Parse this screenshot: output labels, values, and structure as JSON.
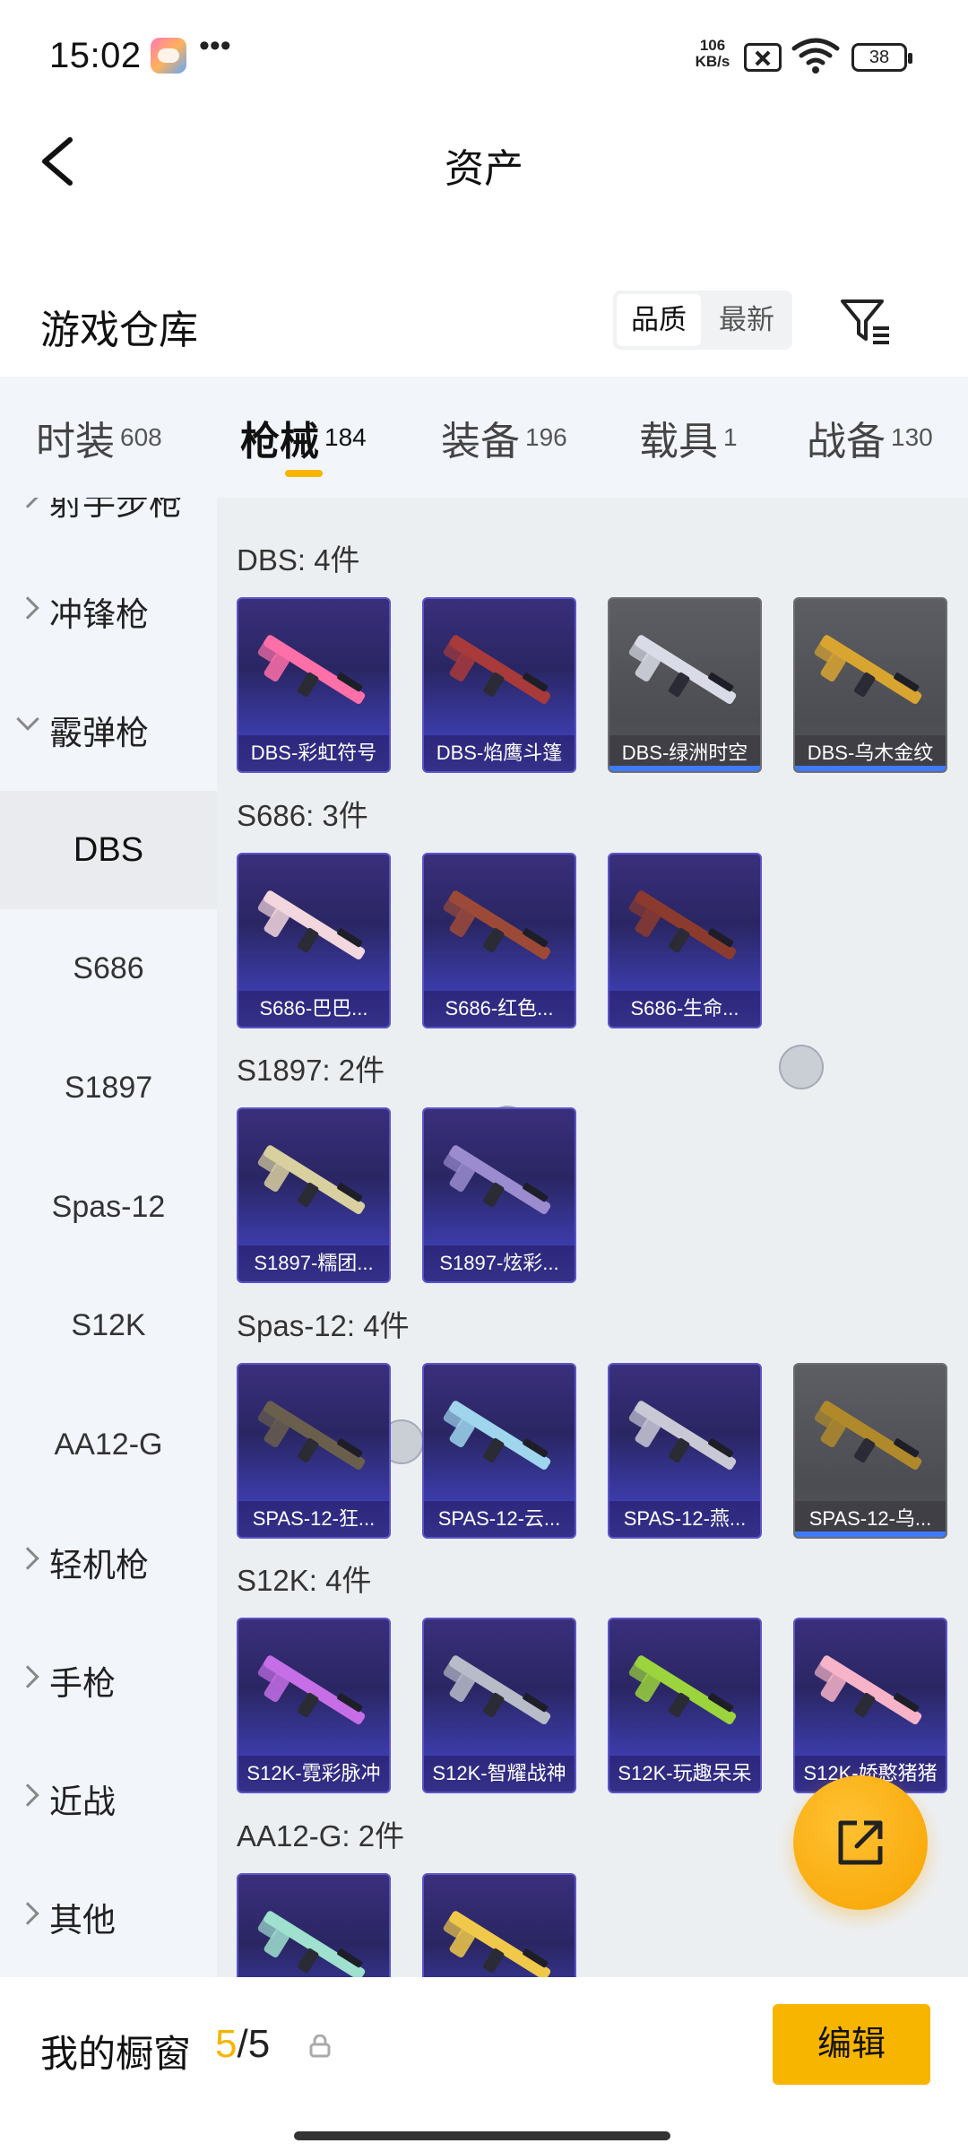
{
  "status_bar": {
    "time": "15:02",
    "more": "•••",
    "speed_value": "106",
    "speed_unit": "KB/s",
    "battery": "38"
  },
  "nav": {
    "title": "资产"
  },
  "warehouse": {
    "title": "游戏仓库",
    "sort": [
      "品质",
      "最新"
    ]
  },
  "tabs": [
    {
      "label": "时装",
      "count": "608"
    },
    {
      "label": "枪械",
      "count": "184"
    },
    {
      "label": "装备",
      "count": "196"
    },
    {
      "label": "载具",
      "count": "1"
    },
    {
      "label": "战备",
      "count": "130"
    }
  ],
  "sidebar": {
    "partial_top": "射手步枪",
    "categories": {
      "smg": "冲锋枪",
      "shotgun": "霰弹枪",
      "lmg": "轻机枪",
      "pistol": "手枪",
      "melee": "近战",
      "other": "其他"
    },
    "sub": [
      "DBS",
      "S686",
      "S1897",
      "Spas-12",
      "S12K",
      "AA12-G"
    ]
  },
  "groups": [
    {
      "title": "DBS: 4件",
      "items": [
        {
          "name": "DBS-彩虹符号",
          "style": "purple",
          "color": "#ff6fa8"
        },
        {
          "name": "DBS-焰鹰斗篷",
          "style": "purple",
          "color": "#a83a3a"
        },
        {
          "name": "DBS-绿洲时空",
          "style": "gray",
          "color": "#d9dce6"
        },
        {
          "name": "DBS-乌木金纹",
          "style": "gray",
          "color": "#d9a531"
        }
      ]
    },
    {
      "title": "S686: 3件",
      "items": [
        {
          "name": "S686-巴巴...",
          "style": "purple",
          "color": "#f3d7de"
        },
        {
          "name": "S686-红色...",
          "style": "purple",
          "color": "#9c4a37"
        },
        {
          "name": "S686-生命...",
          "style": "purple",
          "color": "#8b3b2e"
        }
      ]
    },
    {
      "title": "S1897: 2件",
      "items": [
        {
          "name": "S1897-糯团...",
          "style": "purple",
          "color": "#d9d0a0"
        },
        {
          "name": "S1897-炫彩...",
          "style": "purple",
          "color": "#9a8ccf"
        }
      ]
    },
    {
      "title": "Spas-12: 4件",
      "items": [
        {
          "name": "SPAS-12-狂...",
          "style": "purple",
          "color": "#6a5f4d"
        },
        {
          "name": "SPAS-12-云...",
          "style": "purple",
          "color": "#9fd6ee"
        },
        {
          "name": "SPAS-12-燕...",
          "style": "purple",
          "color": "#c9c9d6"
        },
        {
          "name": "SPAS-12-乌...",
          "style": "gray",
          "color": "#b08a2a"
        }
      ]
    },
    {
      "title": "S12K: 4件",
      "items": [
        {
          "name": "S12K-霓彩脉冲",
          "style": "purple",
          "color": "#c56ee6"
        },
        {
          "name": "S12K-智耀战神",
          "style": "purple",
          "color": "#b8bcc8"
        },
        {
          "name": "S12K-玩趣呆呆",
          "style": "purple",
          "color": "#9bd43c"
        },
        {
          "name": "S12K-娇憨猪猪",
          "style": "purple",
          "color": "#f7b3c8"
        }
      ]
    },
    {
      "title": "AA12-G: 2件",
      "items": [
        {
          "name": "",
          "style": "purple",
          "color": "#9fe0cf"
        },
        {
          "name": "",
          "style": "purple",
          "color": "#f0c94a"
        }
      ]
    }
  ],
  "bottom": {
    "title": "我的橱窗",
    "current": "5",
    "total": "/5",
    "edit": "编辑"
  },
  "colors": {
    "accent": "#f7b500",
    "item_bg": "#2a2663",
    "selected_bg": "#e9ebee"
  }
}
